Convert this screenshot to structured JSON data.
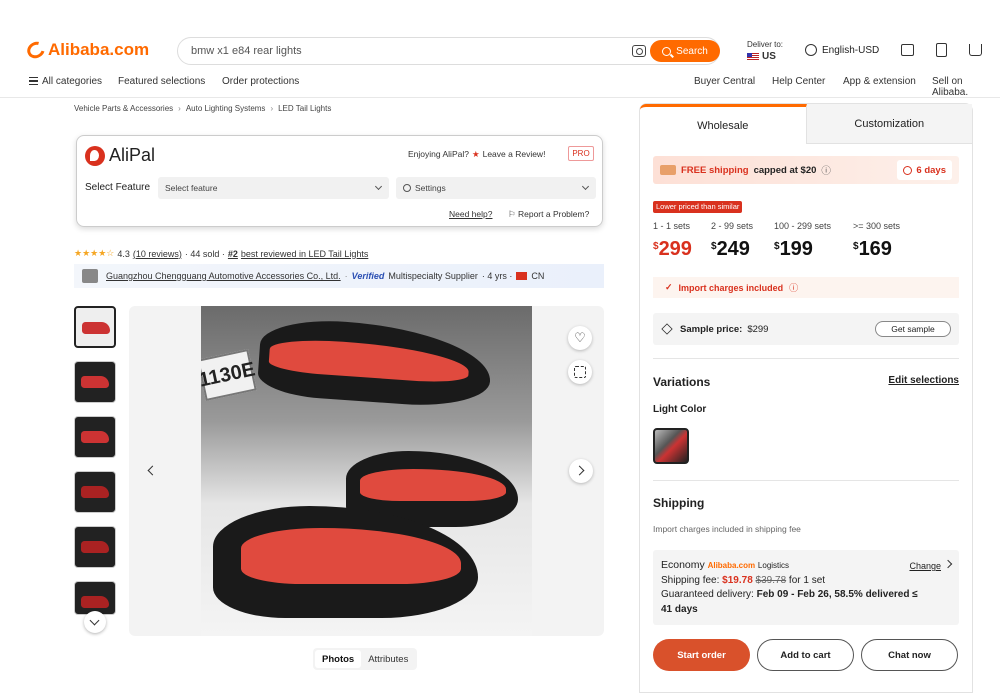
{
  "header": {
    "logo": "Alibaba.com",
    "search_value": "bmw x1 e84 rear lights",
    "search_button": "Search",
    "deliver_to_label": "Deliver to:",
    "deliver_country": "US",
    "language": "English-USD"
  },
  "nav": {
    "all_categories": "All categories",
    "featured": "Featured selections",
    "protections": "Order protections",
    "buyer_central": "Buyer Central",
    "help_center": "Help Center",
    "app": "App & extension",
    "sell": "Sell on Alibaba."
  },
  "breadcrumb": [
    "Vehicle Parts & Accessories",
    "Auto Lighting Systems",
    "LED Tail Lights"
  ],
  "alipal": {
    "name": "AliPal",
    "enjoying": "Enjoying AliPal?",
    "review": "Leave a Review!",
    "pro": "PRO",
    "select_label": "Select Feature",
    "select_value": "Select feature",
    "settings": "Settings",
    "help": "Need help?",
    "report": "Report a Problem?"
  },
  "product": {
    "rating": "4.3",
    "reviews": "(10 reviews)",
    "sold": "· 44 sold ·",
    "best_rank": "#2",
    "best_text": "best reviewed in LED Tail Lights",
    "supplier": "Guangzhou Chengguang Automotive Accessories Co., Ltd.",
    "verified": "Verified",
    "supplier_type": "Multispecialty Supplier",
    "years": "· 4 yrs ·",
    "country": "CN",
    "plate_text": "1130E"
  },
  "gallery": {
    "tab_photos": "Photos",
    "tab_attributes": "Attributes"
  },
  "panel": {
    "tab_wholesale": "Wholesale",
    "tab_customization": "Customization",
    "free_shipping": "FREE shipping",
    "capped": "capped at $20",
    "days": "6 days",
    "lower_badge": "Lower priced than similar",
    "tiers": [
      {
        "qty": "1 - 1 sets",
        "price": "299"
      },
      {
        "qty": "2 - 99 sets",
        "price": "249"
      },
      {
        "qty": "100 - 299 sets",
        "price": "199"
      },
      {
        "qty": ">= 300 sets",
        "price": "169"
      }
    ],
    "currency": "$",
    "import_charges": "Import charges included",
    "sample_label": "Sample price:",
    "sample_value": "$299",
    "get_sample": "Get sample",
    "variations": "Variations",
    "edit_selections": "Edit selections",
    "light_color": "Light Color",
    "shipping": "Shipping",
    "shipping_note": "Import charges included in shipping fee",
    "economy": "Economy",
    "alibaba_logistics": "Alibaba.com",
    "logistics": "Logistics",
    "change": "Change",
    "fee_label": "Shipping fee:",
    "fee": "$19.78",
    "fee_old": "$39.78",
    "fee_for": "for 1 set",
    "delivery_label": "Guaranteed delivery:",
    "delivery_dates": "Feb 09 - Feb 26",
    "delivery_pct": ", 58.5% delivered ≤",
    "delivery_days": "41 days",
    "start_order": "Start order",
    "add_to_cart": "Add to cart",
    "chat_now": "Chat now"
  },
  "colors": {
    "brand": "#ff6a00",
    "accent_red": "#d9311e"
  }
}
